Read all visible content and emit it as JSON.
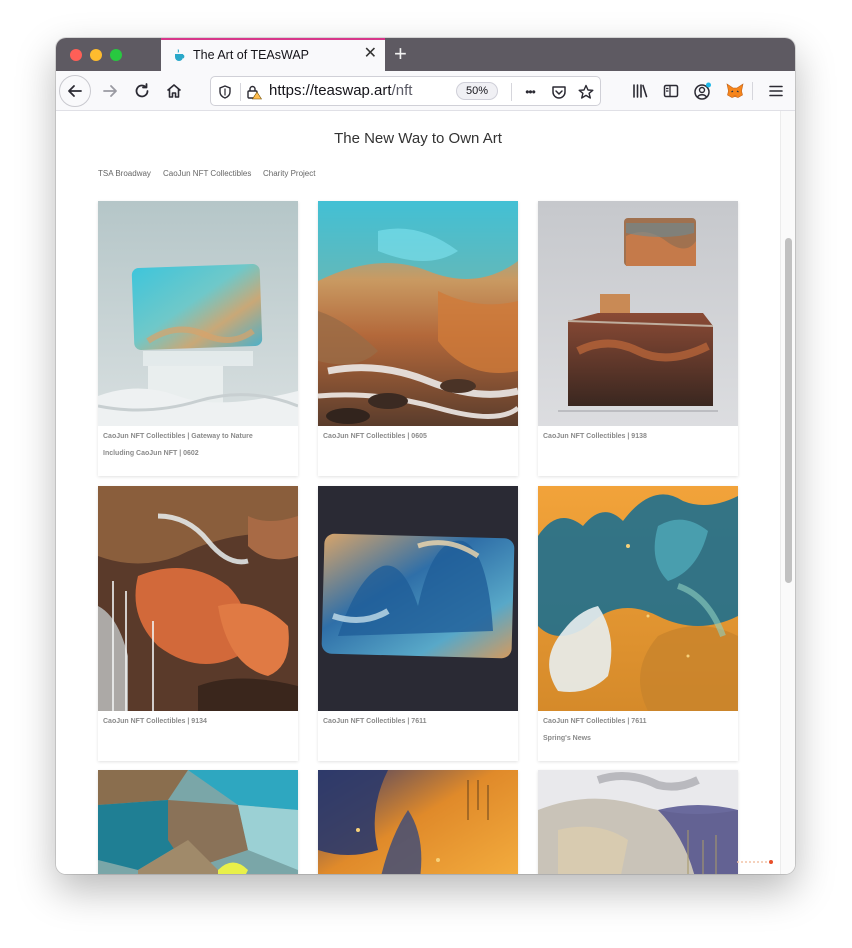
{
  "browser": {
    "tab_title": "The Art of TEAsWAP",
    "tab_close": "✕",
    "new_tab": "+",
    "url_host": "https://teaswap.art",
    "url_path": "/nft",
    "zoom": "50%",
    "page_actions": "•••"
  },
  "page": {
    "title": "The New Way to Own Art",
    "categories": [
      "TSA Broadway",
      "CaoJun NFT Collectibles",
      "Charity Project"
    ],
    "cards": [
      {
        "title": "CaoJun NFT Collectibles | Gateway to Nature",
        "subtitle": "Including CaoJun NFT | 0602"
      },
      {
        "title": "CaoJun NFT Collectibles | 0605",
        "subtitle": ""
      },
      {
        "title": "CaoJun NFT Collectibles | 9138",
        "subtitle": ""
      },
      {
        "title": "CaoJun NFT Collectibles | 9134",
        "subtitle": ""
      },
      {
        "title": "CaoJun NFT Collectibles | 7611",
        "subtitle": ""
      },
      {
        "title": "CaoJun NFT Collectibles | 7611",
        "subtitle": "Spring's News"
      }
    ]
  },
  "colors": {
    "tab_accent": "#d7368a",
    "tabbar_bg": "#5e5a62",
    "loader": "#e8502a"
  },
  "icons": [
    "back-arrow-icon",
    "forward-arrow-icon",
    "reload-icon",
    "home-icon",
    "shield-icon",
    "lock-warning-icon",
    "pocket-icon",
    "bookmark-star-icon",
    "library-icon",
    "sidebar-icon",
    "account-icon",
    "metamask-fox-icon",
    "hamburger-menu-icon"
  ]
}
